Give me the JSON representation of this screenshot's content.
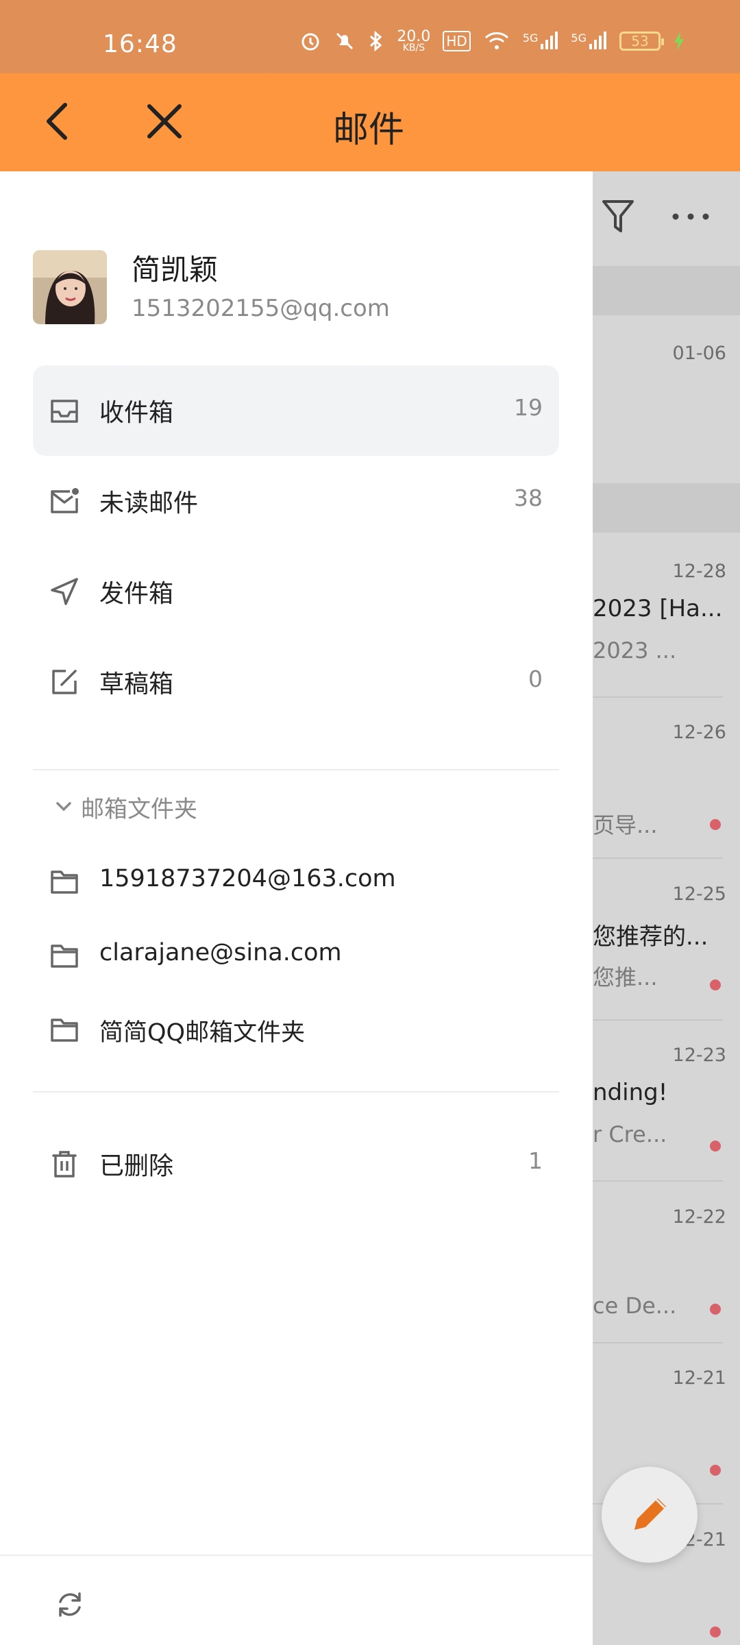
{
  "status_bar": {
    "time": "16:48",
    "net_speed": "20.0",
    "net_unit": "KB/S",
    "hd": "HD",
    "sim1": "5G",
    "sim2": "5G",
    "battery": "53"
  },
  "header": {
    "title": "邮件"
  },
  "account": {
    "name": "简凯颖",
    "email": "1513202155@qq.com"
  },
  "menu": [
    {
      "label": "收件箱",
      "count": "19"
    },
    {
      "label": "未读邮件",
      "count": "38"
    },
    {
      "label": "发件箱",
      "count": ""
    },
    {
      "label": "草稿箱",
      "count": "0"
    }
  ],
  "folders_section": {
    "title": "邮箱文件夹"
  },
  "folders": [
    {
      "label": "15918737204@163.com"
    },
    {
      "label": "clarajane@sina.com"
    },
    {
      "label": "简简QQ邮箱文件夹"
    }
  ],
  "trash": {
    "label": "已删除",
    "count": "1"
  },
  "background_list": [
    {
      "date": "01-06",
      "line1": "",
      "line2": ""
    },
    {
      "date": "12-28",
      "line1": "2023 [Ha...",
      "line2": "2023 ..."
    },
    {
      "date": "12-26",
      "line1": "",
      "line2": "页导..."
    },
    {
      "date": "12-25",
      "line1": "您推荐的...",
      "line2": "您推..."
    },
    {
      "date": "12-23",
      "line1": "nding!",
      "line2": "r Cre..."
    },
    {
      "date": "12-22",
      "line1": "",
      "line2": "ce De..."
    },
    {
      "date": "12-21",
      "line1": "",
      "line2": ""
    },
    {
      "date": "12-21",
      "line1": "",
      "line2": ""
    }
  ],
  "colors": {
    "header": "#fd963f",
    "status_bar": "#e08f56",
    "accent_dot": "#d8616a",
    "fab_pencil": "#e8731f"
  }
}
